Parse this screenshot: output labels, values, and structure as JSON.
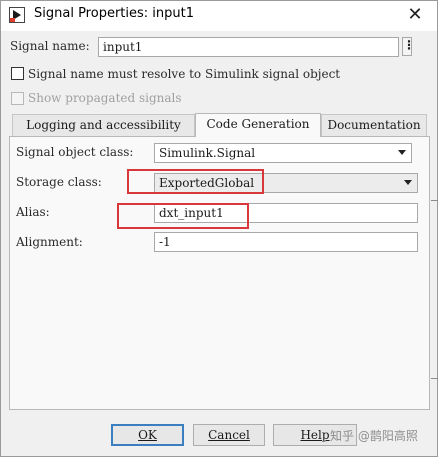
{
  "window": {
    "title": "Signal Properties: input1",
    "icon": "simulink-signal-icon",
    "close_icon": "close-icon"
  },
  "signal_name": {
    "label": "Signal name:",
    "value": "input1",
    "more_button": "⋮"
  },
  "options": {
    "resolve_label": "Signal name must resolve to Simulink signal object",
    "resolve_checked": false,
    "propagated_label": "Show propagated signals",
    "propagated_enabled": false
  },
  "tabs": [
    {
      "label": "Logging and accessibility",
      "active": false
    },
    {
      "label": "Code Generation",
      "active": true
    },
    {
      "label": "Documentation",
      "active": false
    }
  ],
  "code_generation": {
    "signal_object_class_label": "Signal object class:",
    "signal_object_class_value": "Simulink.Signal",
    "storage_class_label": "Storage class:",
    "storage_class_value": "ExportedGlobal",
    "alias_label": "Alias:",
    "alias_value": "dxt_input1",
    "alignment_label": "Alignment:",
    "alignment_value": "-1"
  },
  "buttons": {
    "ok": "OK",
    "cancel": "Cancel",
    "help": "Help"
  },
  "watermark": "知乎 @鹊阳高照",
  "colors": {
    "highlight_box": "#d9383a",
    "default_button_border": "#3c7fc1"
  }
}
